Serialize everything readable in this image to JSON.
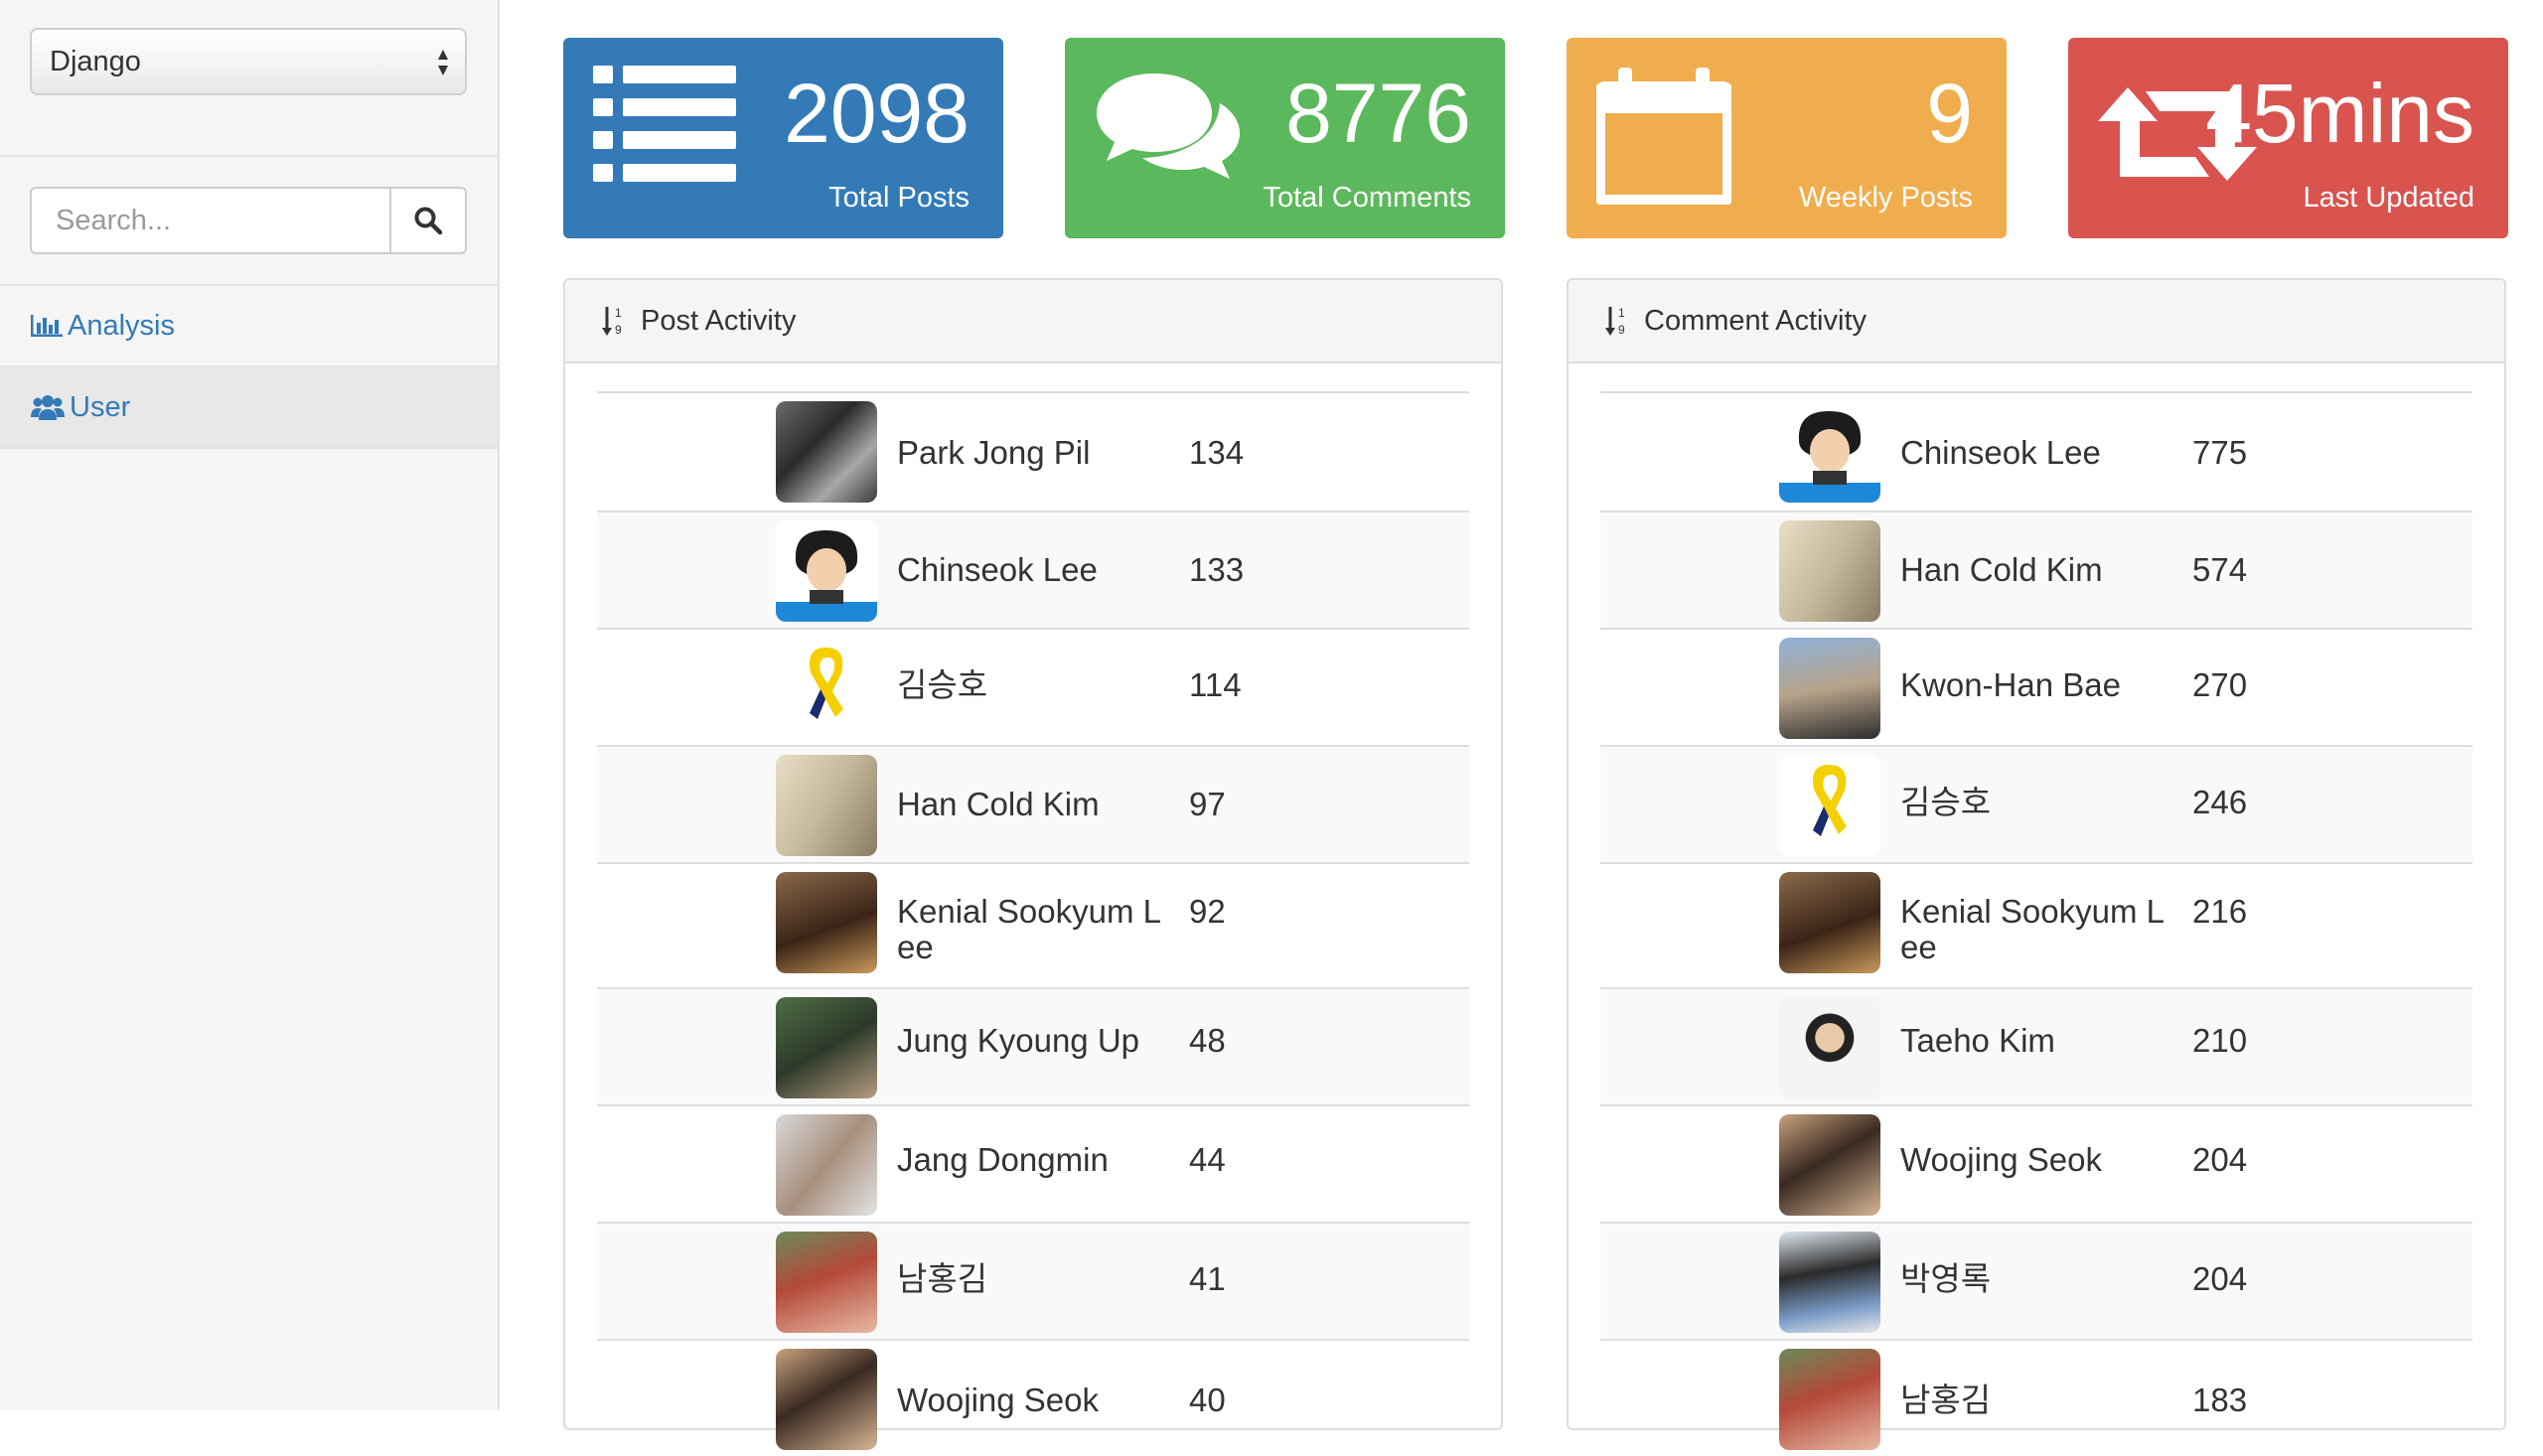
{
  "sidebar": {
    "select_value": "Django",
    "search_placeholder": "Search...",
    "nav": [
      {
        "label": "Analysis",
        "icon": "bar-chart-icon"
      },
      {
        "label": "User",
        "icon": "users-icon",
        "active": true
      }
    ]
  },
  "stats": [
    {
      "value": "2098",
      "label": "Total Posts",
      "color": "#337ab7",
      "icon": "list-icon"
    },
    {
      "value": "8776",
      "label": "Total Comments",
      "color": "#5cb85c",
      "icon": "comments-icon"
    },
    {
      "value": "9",
      "label": "Weekly Posts",
      "color": "#f0ad4e",
      "icon": "calendar-icon"
    },
    {
      "value": "45mins",
      "label": "Last Updated",
      "color": "#d9534f",
      "icon": "retweet-icon"
    }
  ],
  "post_activity": {
    "title": "Post Activity",
    "rows": [
      {
        "name": "Park Jong Pil",
        "count": "134"
      },
      {
        "name": "Chinseok Lee",
        "count": "133"
      },
      {
        "name": "김승호",
        "count": "114"
      },
      {
        "name": "Han Cold Kim",
        "count": "97"
      },
      {
        "name": "Kenial Sookyum Lee",
        "count": "92"
      },
      {
        "name": "Jung Kyoung Up",
        "count": "48"
      },
      {
        "name": "Jang Dongmin",
        "count": "44"
      },
      {
        "name": "남홍김",
        "count": "41"
      },
      {
        "name": "Woojing Seok",
        "count": "40"
      }
    ]
  },
  "comment_activity": {
    "title": "Comment Activity",
    "rows": [
      {
        "name": "Chinseok Lee",
        "count": "775"
      },
      {
        "name": "Han Cold Kim",
        "count": "574"
      },
      {
        "name": "Kwon-Han Bae",
        "count": "270"
      },
      {
        "name": "김승호",
        "count": "246"
      },
      {
        "name": "Kenial Sookyum Lee",
        "count": "216"
      },
      {
        "name": "Taeho Kim",
        "count": "210"
      },
      {
        "name": "Woojing Seok",
        "count": "204"
      },
      {
        "name": "박영록",
        "count": "204"
      },
      {
        "name": "남홍김",
        "count": "183"
      }
    ]
  }
}
